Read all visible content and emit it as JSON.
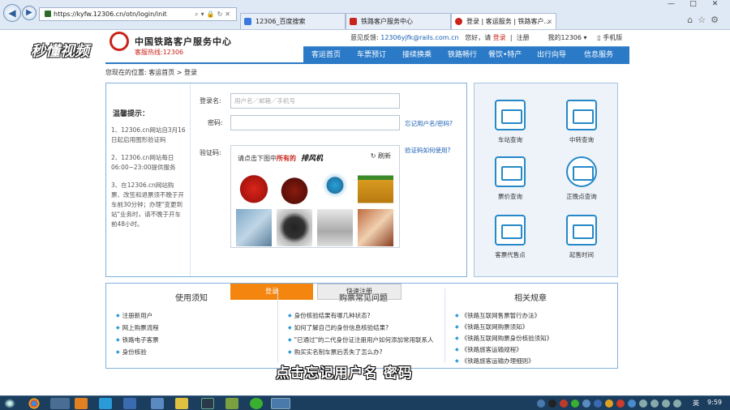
{
  "browser": {
    "url": "https://kyfw.12306.cn/otn/login/init",
    "tabs": [
      {
        "label": "12306_百度搜索",
        "active": false
      },
      {
        "label": "铁路客户服务中心",
        "active": false
      },
      {
        "label": "登录 | 客运服务 | 铁路客户...",
        "active": true
      }
    ]
  },
  "header": {
    "site_title": "中国铁路客户服务中心",
    "hotline": "客服热线:12306",
    "watermark": "秒懂视频",
    "feedback_label": "意见反馈:",
    "feedback_email": "12306yjfk@rails.com.cn",
    "greeting": "您好，请",
    "login_link": "登录",
    "separator": "|",
    "register_link": "注册",
    "my12306": "我的12306",
    "mobile": "手机版"
  },
  "nav": {
    "items": [
      "客运首页",
      "车票预订",
      "接续换乘",
      "铁路畅行",
      "餐饮•特产",
      "出行向导",
      "信息服务"
    ]
  },
  "breadcrumb": {
    "prefix": "您现在的位置:",
    "home": "客运首页",
    "arrow": ">",
    "current": "登录"
  },
  "tips": {
    "title": "温馨提示：",
    "items": [
      "1、12306.cn网站自3月16日起启用图形验证码",
      "2、12306.cn网站每日06:00~23:00提供服务",
      "3、在12306.cn网站购票、改签和退票须不晚于开车前30分钟；办理\"变更到站\"业务时，请不晚于开车前48小时。"
    ]
  },
  "login": {
    "username_label": "登录名:",
    "username_placeholder": "用户名／邮箱／手机号",
    "password_label": "密码:",
    "forgot_link": "忘记用户名/密码?",
    "captcha_label": "验证码:",
    "captcha_help_link": "验证码如何使用?",
    "captcha_prompt": "请点击下图中",
    "captcha_prompt_red": "所有的",
    "captcha_target": "排风机",
    "captcha_refresh": "刷新",
    "login_button": "登录",
    "register_button": "快速注册"
  },
  "quick_links": [
    {
      "label": "车站查询",
      "icon": "station-icon"
    },
    {
      "label": "中转查询",
      "icon": "transfer-icon"
    },
    {
      "label": "票价查询",
      "icon": "price-icon"
    },
    {
      "label": "正晚点查询",
      "icon": "clock-icon"
    },
    {
      "label": "客票代售点",
      "icon": "ticket-agent-icon"
    },
    {
      "label": "起售时间",
      "icon": "sale-time-icon"
    }
  ],
  "info": {
    "columns": [
      {
        "title": "使用须知",
        "items": [
          "注册新用户",
          "网上购票流程",
          "铁路电子客票",
          "身份核验"
        ]
      },
      {
        "title": "购票常见问题",
        "items": [
          "身份核验结果有哪几种状态?",
          "如何了解自己的身份信息核验结果?",
          "\"已通过\"的二代身份证注册用户如何添加常用联系人",
          "购买实名制车票后丢失了怎么办?"
        ]
      },
      {
        "title": "相关规章",
        "items": [
          "《铁路互联网售票暂行办法》",
          "《铁路互联网购票须知》",
          "《铁路互联网购票身份核验须知》",
          "《铁路旅客运输规程》",
          "《铁路旅客运输办理细则》"
        ]
      }
    ]
  },
  "subtitle": "点击忘记用户名 密码",
  "taskbar": {
    "lang": "英",
    "clock": "9:59"
  },
  "colors": {
    "nav_blue": "#2a7ac8",
    "login_orange": "#f4850f",
    "brand_red": "#c9231a"
  }
}
